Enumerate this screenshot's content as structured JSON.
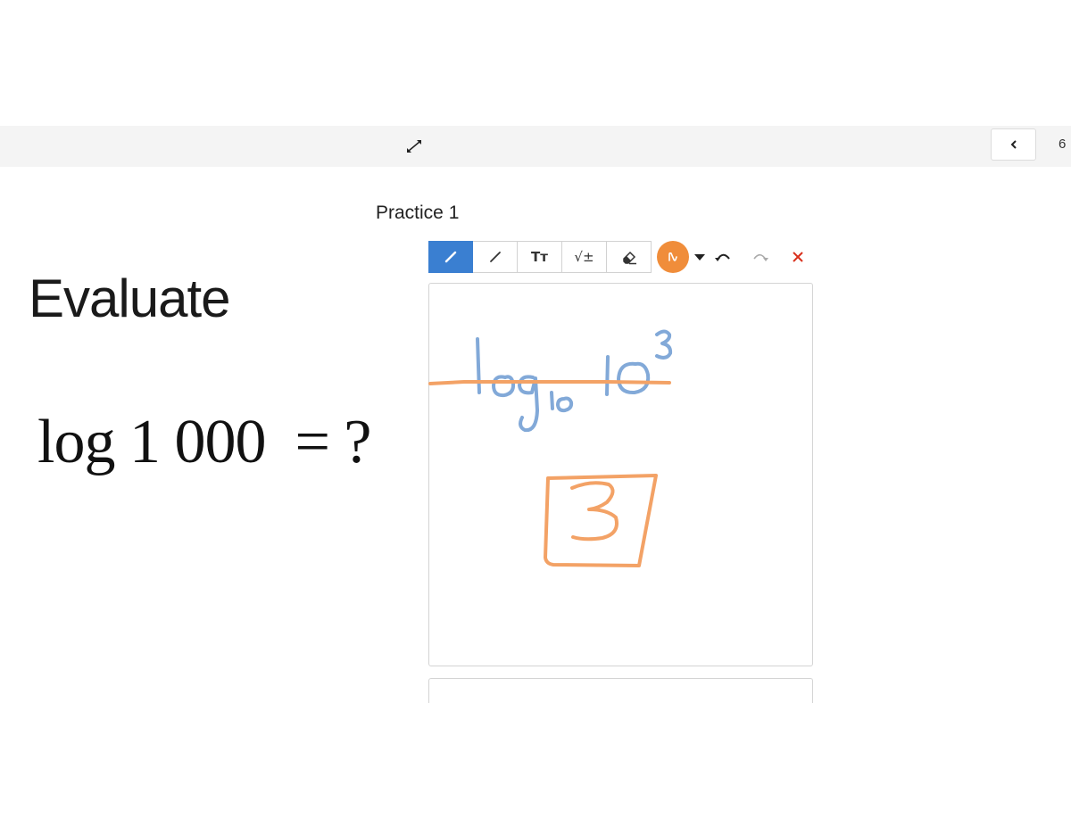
{
  "topbar": {
    "page_number": "6",
    "icons": {
      "expand": "expand-arrows-icon",
      "prev": "chevron-left-icon"
    }
  },
  "slide": {
    "heading": "Evaluate",
    "equation": "log 1 000  = ?"
  },
  "practice": {
    "title": "Practice 1",
    "tools": [
      {
        "name": "pen-tool",
        "icon": "pencil-icon",
        "label": "",
        "active": true
      },
      {
        "name": "line-tool",
        "icon": "line-icon",
        "label": "",
        "active": false
      },
      {
        "name": "text-tool",
        "icon": "text-size-icon",
        "label": "Tт",
        "active": false
      },
      {
        "name": "math-tool",
        "icon": "sqrt-icon",
        "label": "√±",
        "active": false
      },
      {
        "name": "eraser-tool",
        "icon": "eraser-icon",
        "label": "",
        "active": false
      }
    ],
    "current_color": "#f08d3a",
    "colors": {
      "accent": "#3a7fd1",
      "pen_blue": "#82a9d8",
      "pen_orange": "#f3a266",
      "clear": "#d9301c"
    }
  }
}
